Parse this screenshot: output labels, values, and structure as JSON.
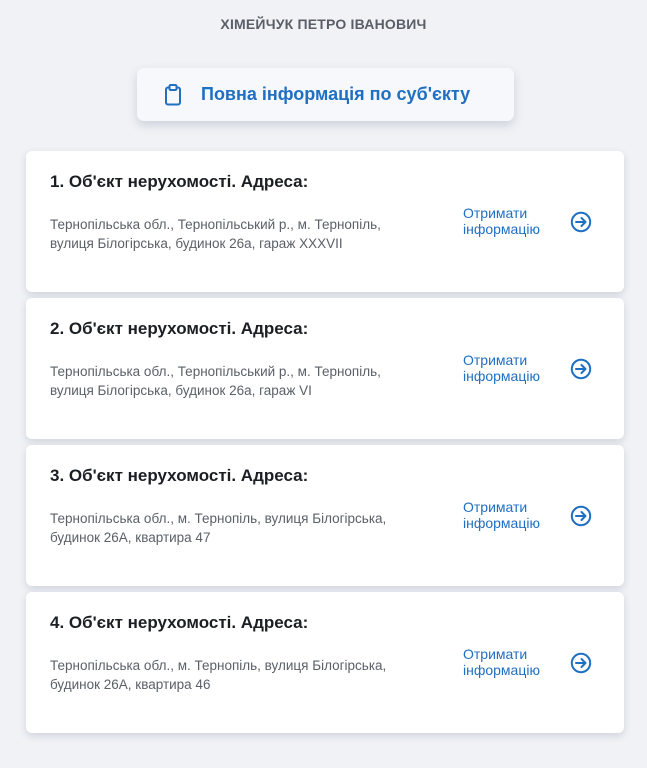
{
  "owner_name": "ХІМЕЙЧУК ПЕТРО ІВАНОВИЧ",
  "full_info_button": {
    "label": "Повна інформація по суб'єкту",
    "icon": "clipboard-icon"
  },
  "accent_color": "#1f6fc2",
  "objects": [
    {
      "title": "1. Об'єкт нерухомості. Адреса:",
      "address": "Тернопільська обл., Тернопільський р., м. Тернопіль, вулиця Білогірська, будинок 26а, гараж XXXVII",
      "action_label": "Отримати інформацію",
      "action_icon": "arrow-right-circle-icon"
    },
    {
      "title": "2. Об'єкт нерухомості. Адреса:",
      "address": "Тернопільська обл., Тернопільський р., м. Тернопіль, вулиця Білогірська, будинок 26а, гараж VI",
      "action_label": "Отримати інформацію",
      "action_icon": "arrow-right-circle-icon"
    },
    {
      "title": "3. Об'єкт нерухомості. Адреса:",
      "address": "Тернопільська обл., м. Тернопіль, вулиця Білогірська, будинок 26А, квартира 47",
      "action_label": "Отримати інформацію",
      "action_icon": "arrow-right-circle-icon"
    },
    {
      "title": "4. Об'єкт нерухомості. Адреса:",
      "address": "Тернопільська обл., м. Тернопіль, вулиця Білогірська, будинок 26А, квартира 46",
      "action_label": "Отримати інформацію",
      "action_icon": "arrow-right-circle-icon"
    }
  ]
}
